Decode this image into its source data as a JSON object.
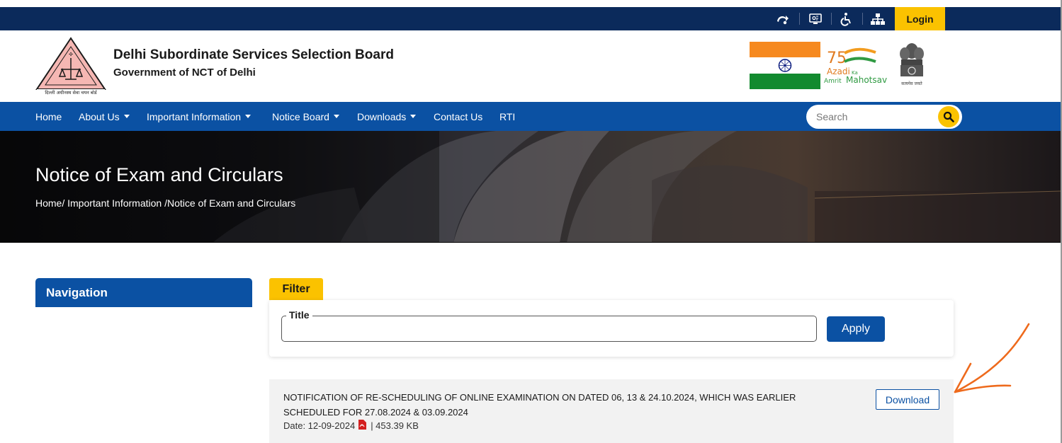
{
  "topbar": {
    "icons": [
      "skip-to-content-icon",
      "screen-reader-icon",
      "accessibility-icon",
      "sitemap-icon"
    ],
    "login_label": "Login",
    "colors": {
      "background": "#0b2a5b",
      "login": "#fbc200"
    }
  },
  "header": {
    "org_title": "Delhi Subordinate Services Selection Board",
    "org_subtitle": "Government of NCT of Delhi",
    "logo_text": "दिल्ली अधीनस्थ सेवा चयन बोर्ड",
    "azadi": {
      "number": "75",
      "line1": "Azadi",
      "ka": "Ka",
      "line2": "Amrit",
      "line3": "Mahotsav"
    },
    "emblem_caption": "सत्यमेव जयते"
  },
  "nav": {
    "items": [
      {
        "label": "Home",
        "has_dropdown": false
      },
      {
        "label": "About Us",
        "has_dropdown": true
      },
      {
        "label": "Important Information",
        "has_dropdown": true
      },
      {
        "label": "Notice Board",
        "has_dropdown": true
      },
      {
        "label": "Downloads",
        "has_dropdown": true
      },
      {
        "label": "Contact Us",
        "has_dropdown": false
      },
      {
        "label": "RTI",
        "has_dropdown": false
      }
    ],
    "search_placeholder": "Search",
    "search_value": "",
    "colors": {
      "background": "#0b51a3"
    }
  },
  "banner": {
    "title": "Notice of Exam and Circulars",
    "breadcrumb": "Home/ Important Information /Notice of Exam and Circulars"
  },
  "sidebar": {
    "heading": "Navigation"
  },
  "filter": {
    "tab_label": "Filter",
    "title_label": "Title",
    "title_value": "",
    "apply_label": "Apply"
  },
  "notices": [
    {
      "title": "NOTIFICATION OF RE-SCHEDULING OF ONLINE EXAMINATION ON DATED 06, 13 & 24.10.2024, WHICH WAS EARLIER SCHEDULED FOR 27.08.2024 & 03.09.2024",
      "date_label": "Date: 12-09-2024",
      "file_type_icon": "pdf-icon",
      "size": "| 453.39 KB",
      "download_label": "Download"
    }
  ]
}
